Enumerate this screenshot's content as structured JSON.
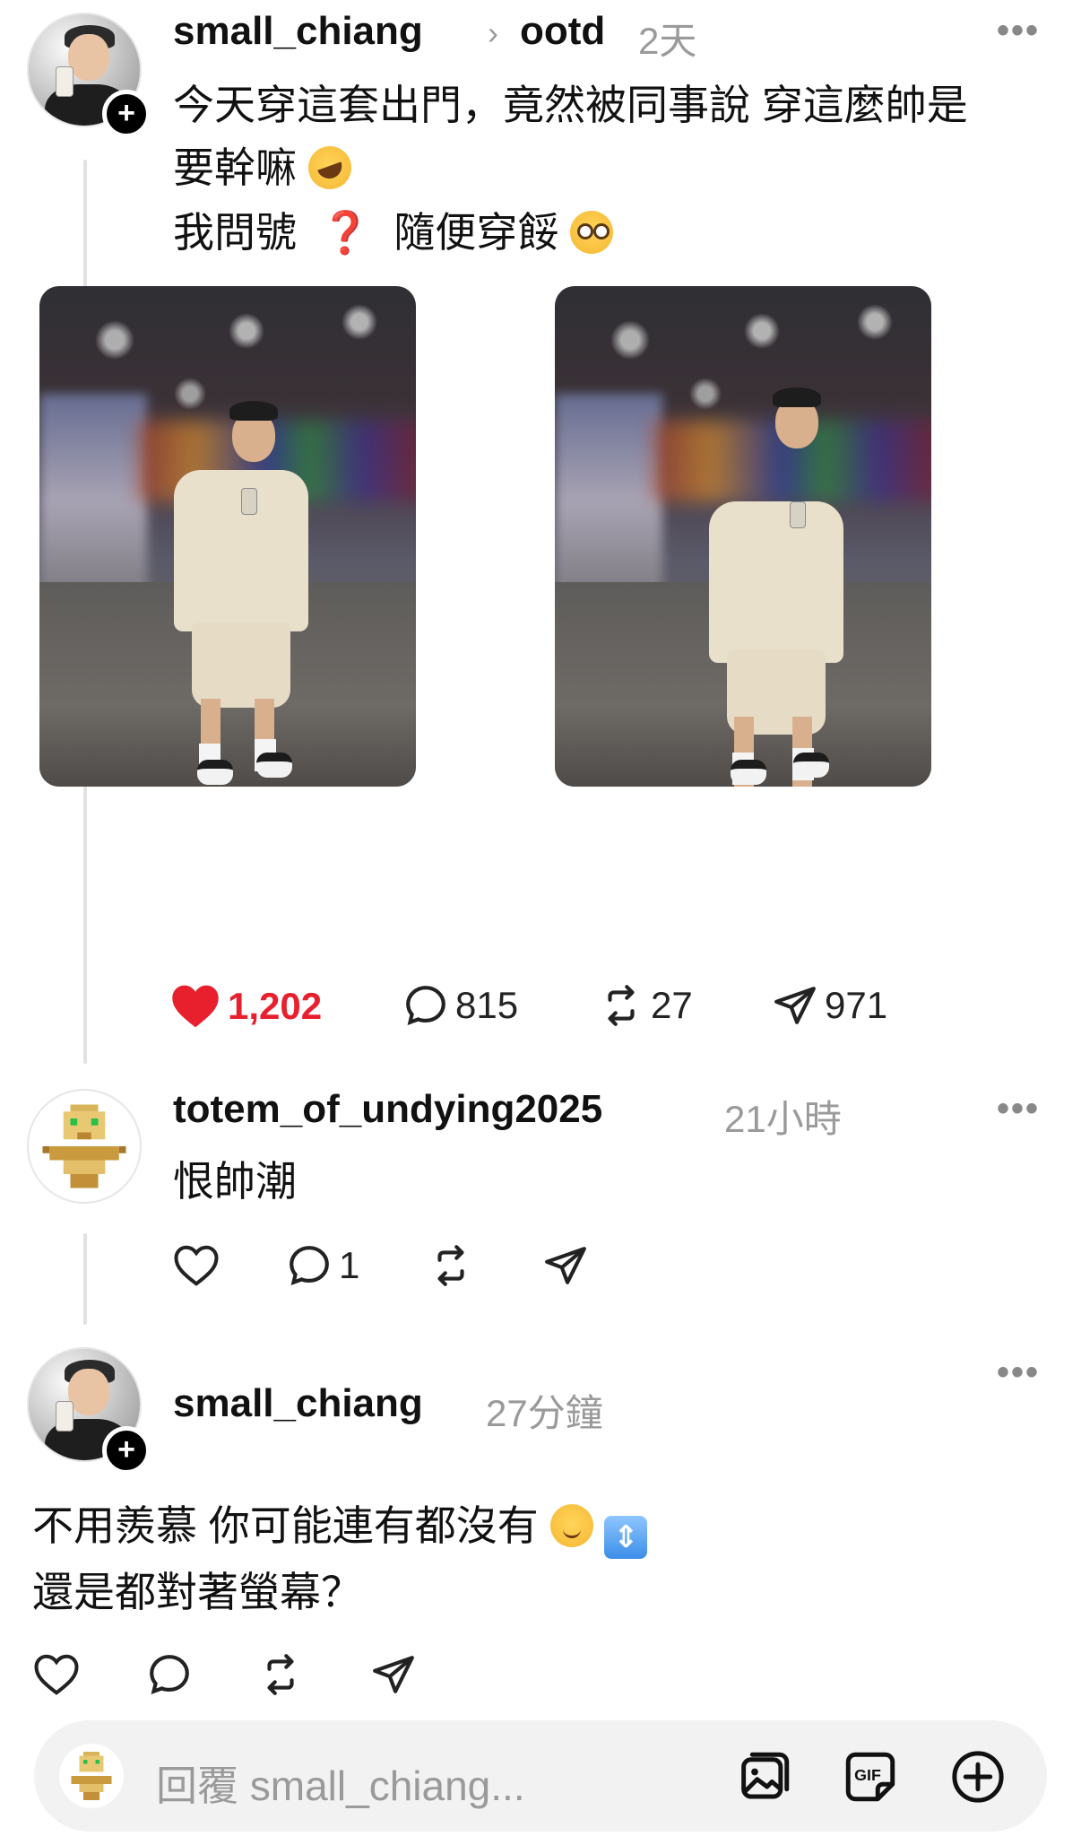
{
  "post": {
    "username": "small_chiang",
    "community": "ootd",
    "time": "2天",
    "text_line1": "今天穿這套出門，竟然被同事說 穿這麼帥是",
    "text_line2": "要幹嘛",
    "text_line3_a": "我問號",
    "text_line3_b": "隨便穿餒",
    "likes": "1,202",
    "comments": "815",
    "reposts": "27",
    "shares": "971"
  },
  "reply1": {
    "username": "totem_of_undying2025",
    "time": "21小時",
    "text": "恨帥潮",
    "comments": "1"
  },
  "reply2": {
    "username": "small_chiang",
    "time": "27分鐘",
    "text_line1": "不用羨慕  你可能連有都沒有",
    "text_line2": "還是都對著螢幕？"
  },
  "reply_bar": {
    "placeholder": "回覆 small_chiang..."
  },
  "icons": {
    "more": "more-horizontal-icon",
    "heart": "heart-icon",
    "comment": "comment-bubble-icon",
    "repost": "repost-icon",
    "share": "send-icon",
    "gallery": "photo-gallery-icon",
    "gif": "gif-icon",
    "add": "plus-circle-icon"
  },
  "colors": {
    "like_active": "#e8202e",
    "secondary_text": "#9a9a9a"
  }
}
